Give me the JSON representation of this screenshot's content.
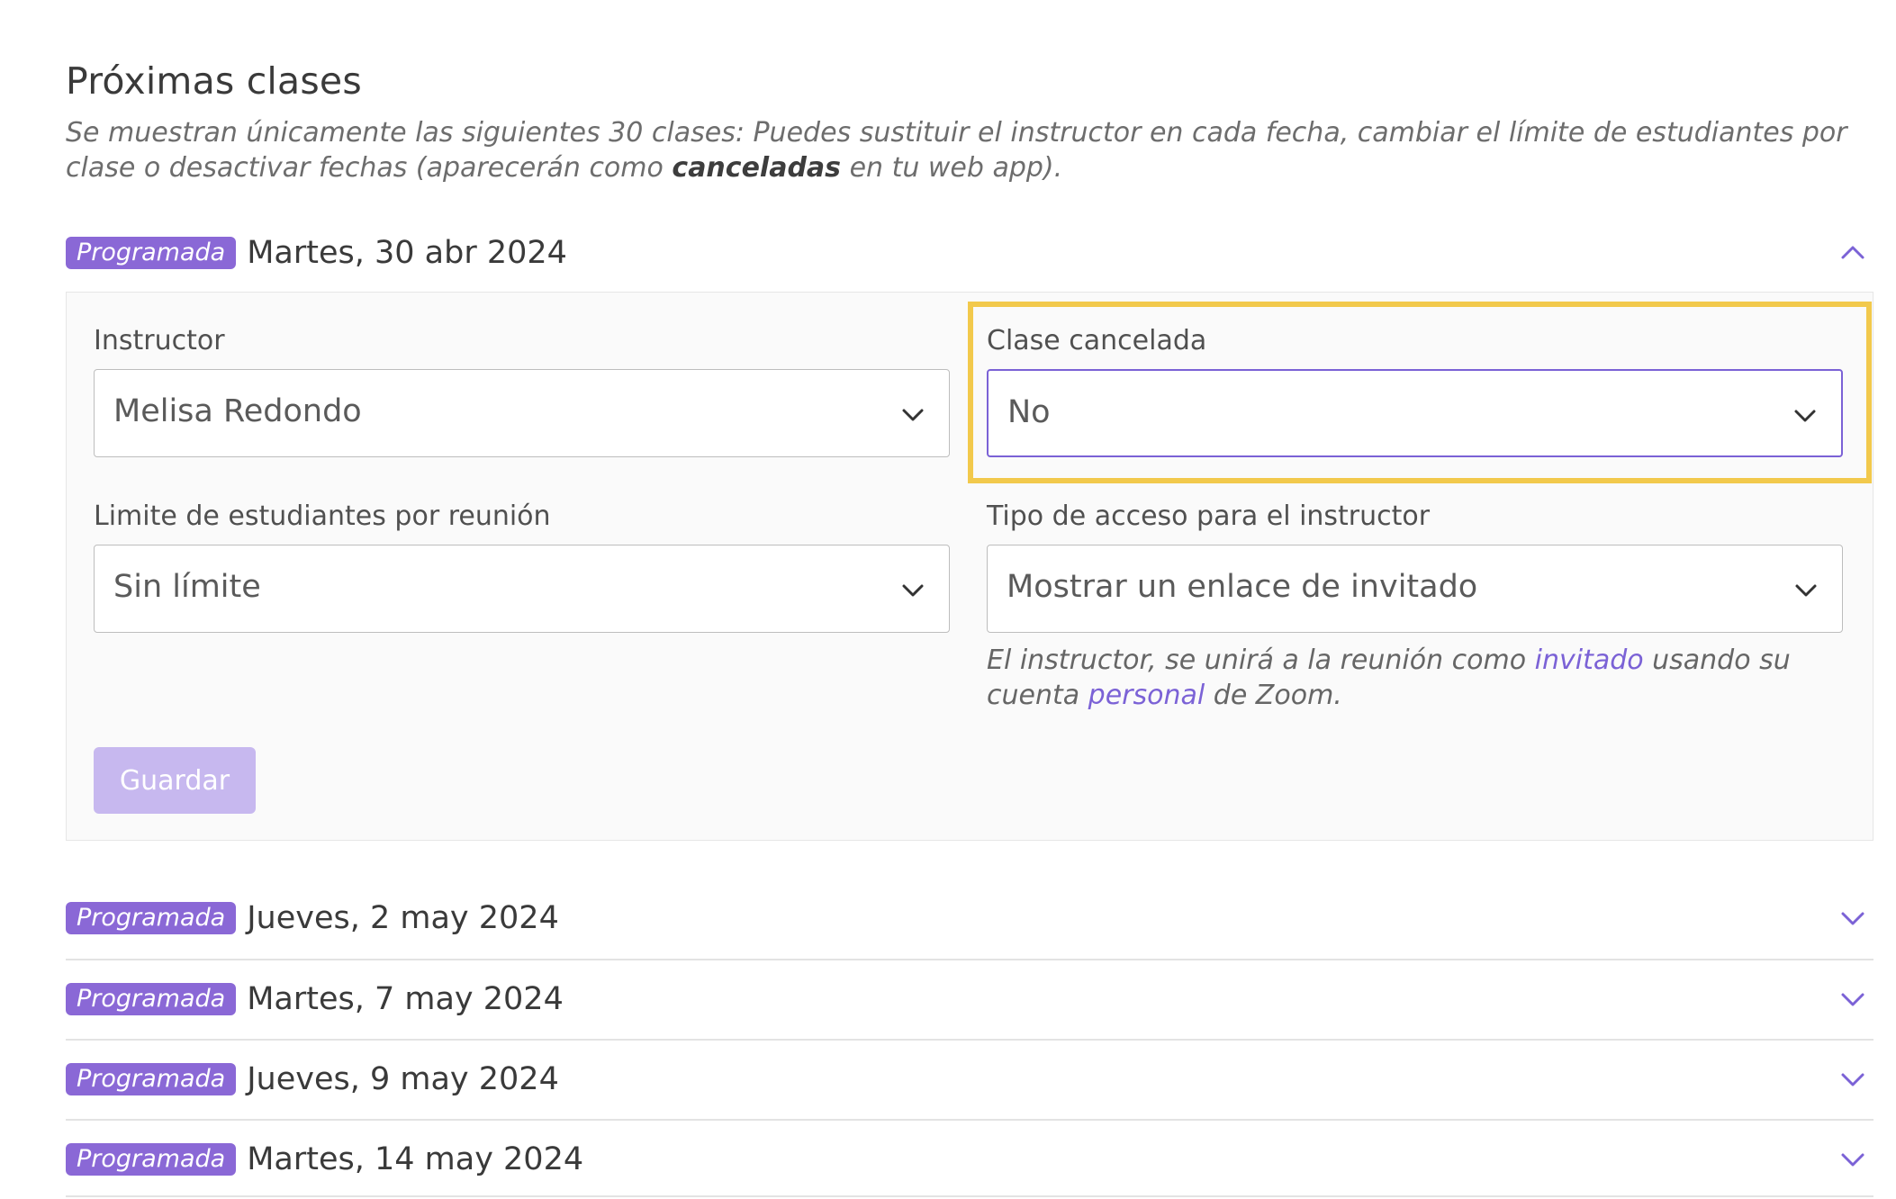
{
  "section": {
    "title": "Próximas clases",
    "description_part1": "Se muestran únicamente las siguientes 30 clases: Puedes sustituir el instructor en cada fecha, cambiar el límite de estudiantes por clase o desactivar fechas (aparecerán como ",
    "description_bold": "canceladas",
    "description_part2": " en tu web app)."
  },
  "classes": [
    {
      "status": "Programada",
      "date": "Martes, 30 abr 2024"
    },
    {
      "status": "Programada",
      "date": "Jueves, 2 may 2024"
    },
    {
      "status": "Programada",
      "date": "Martes, 7 may 2024"
    },
    {
      "status": "Programada",
      "date": "Jueves, 9 may 2024"
    },
    {
      "status": "Programada",
      "date": "Martes, 14 may 2024"
    }
  ],
  "form": {
    "instructor_label": "Instructor",
    "instructor_value": "Melisa Redondo",
    "cancelled_label": "Clase cancelada",
    "cancelled_value": "No",
    "limit_label": "Limite de estudiantes por reunión",
    "limit_value": "Sin límite",
    "access_label": "Tipo de acceso para el instructor",
    "access_value": "Mostrar un enlace de invitado",
    "hint_part1": "El instructor, se unirá a la reunión como ",
    "hint_link1": "invitado",
    "hint_part2": " usando su cuenta ",
    "hint_link2": "personal",
    "hint_part3": " de Zoom.",
    "save_label": "Guardar"
  },
  "colors": {
    "accent": "#8a68d6",
    "highlight": "#f2c94c",
    "save_disabled": "#c7b8ef"
  },
  "icons": {
    "expanded": "chevron-up-icon",
    "collapsed": "chevron-down-icon",
    "select": "chevron-down-icon"
  }
}
